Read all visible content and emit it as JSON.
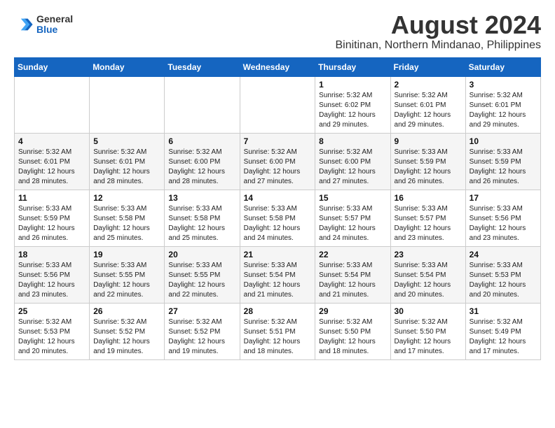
{
  "logo": {
    "general": "General",
    "blue": "Blue"
  },
  "title": {
    "month_year": "August 2024",
    "location": "Binitinan, Northern Mindanao, Philippines"
  },
  "weekdays": [
    "Sunday",
    "Monday",
    "Tuesday",
    "Wednesday",
    "Thursday",
    "Friday",
    "Saturday"
  ],
  "weeks": [
    [
      {
        "day": "",
        "info": ""
      },
      {
        "day": "",
        "info": ""
      },
      {
        "day": "",
        "info": ""
      },
      {
        "day": "",
        "info": ""
      },
      {
        "day": "1",
        "info": "Sunrise: 5:32 AM\nSunset: 6:02 PM\nDaylight: 12 hours\nand 29 minutes."
      },
      {
        "day": "2",
        "info": "Sunrise: 5:32 AM\nSunset: 6:01 PM\nDaylight: 12 hours\nand 29 minutes."
      },
      {
        "day": "3",
        "info": "Sunrise: 5:32 AM\nSunset: 6:01 PM\nDaylight: 12 hours\nand 29 minutes."
      }
    ],
    [
      {
        "day": "4",
        "info": "Sunrise: 5:32 AM\nSunset: 6:01 PM\nDaylight: 12 hours\nand 28 minutes."
      },
      {
        "day": "5",
        "info": "Sunrise: 5:32 AM\nSunset: 6:01 PM\nDaylight: 12 hours\nand 28 minutes."
      },
      {
        "day": "6",
        "info": "Sunrise: 5:32 AM\nSunset: 6:00 PM\nDaylight: 12 hours\nand 28 minutes."
      },
      {
        "day": "7",
        "info": "Sunrise: 5:32 AM\nSunset: 6:00 PM\nDaylight: 12 hours\nand 27 minutes."
      },
      {
        "day": "8",
        "info": "Sunrise: 5:32 AM\nSunset: 6:00 PM\nDaylight: 12 hours\nand 27 minutes."
      },
      {
        "day": "9",
        "info": "Sunrise: 5:33 AM\nSunset: 5:59 PM\nDaylight: 12 hours\nand 26 minutes."
      },
      {
        "day": "10",
        "info": "Sunrise: 5:33 AM\nSunset: 5:59 PM\nDaylight: 12 hours\nand 26 minutes."
      }
    ],
    [
      {
        "day": "11",
        "info": "Sunrise: 5:33 AM\nSunset: 5:59 PM\nDaylight: 12 hours\nand 26 minutes."
      },
      {
        "day": "12",
        "info": "Sunrise: 5:33 AM\nSunset: 5:58 PM\nDaylight: 12 hours\nand 25 minutes."
      },
      {
        "day": "13",
        "info": "Sunrise: 5:33 AM\nSunset: 5:58 PM\nDaylight: 12 hours\nand 25 minutes."
      },
      {
        "day": "14",
        "info": "Sunrise: 5:33 AM\nSunset: 5:58 PM\nDaylight: 12 hours\nand 24 minutes."
      },
      {
        "day": "15",
        "info": "Sunrise: 5:33 AM\nSunset: 5:57 PM\nDaylight: 12 hours\nand 24 minutes."
      },
      {
        "day": "16",
        "info": "Sunrise: 5:33 AM\nSunset: 5:57 PM\nDaylight: 12 hours\nand 23 minutes."
      },
      {
        "day": "17",
        "info": "Sunrise: 5:33 AM\nSunset: 5:56 PM\nDaylight: 12 hours\nand 23 minutes."
      }
    ],
    [
      {
        "day": "18",
        "info": "Sunrise: 5:33 AM\nSunset: 5:56 PM\nDaylight: 12 hours\nand 23 minutes."
      },
      {
        "day": "19",
        "info": "Sunrise: 5:33 AM\nSunset: 5:55 PM\nDaylight: 12 hours\nand 22 minutes."
      },
      {
        "day": "20",
        "info": "Sunrise: 5:33 AM\nSunset: 5:55 PM\nDaylight: 12 hours\nand 22 minutes."
      },
      {
        "day": "21",
        "info": "Sunrise: 5:33 AM\nSunset: 5:54 PM\nDaylight: 12 hours\nand 21 minutes."
      },
      {
        "day": "22",
        "info": "Sunrise: 5:33 AM\nSunset: 5:54 PM\nDaylight: 12 hours\nand 21 minutes."
      },
      {
        "day": "23",
        "info": "Sunrise: 5:33 AM\nSunset: 5:54 PM\nDaylight: 12 hours\nand 20 minutes."
      },
      {
        "day": "24",
        "info": "Sunrise: 5:33 AM\nSunset: 5:53 PM\nDaylight: 12 hours\nand 20 minutes."
      }
    ],
    [
      {
        "day": "25",
        "info": "Sunrise: 5:32 AM\nSunset: 5:53 PM\nDaylight: 12 hours\nand 20 minutes."
      },
      {
        "day": "26",
        "info": "Sunrise: 5:32 AM\nSunset: 5:52 PM\nDaylight: 12 hours\nand 19 minutes."
      },
      {
        "day": "27",
        "info": "Sunrise: 5:32 AM\nSunset: 5:52 PM\nDaylight: 12 hours\nand 19 minutes."
      },
      {
        "day": "28",
        "info": "Sunrise: 5:32 AM\nSunset: 5:51 PM\nDaylight: 12 hours\nand 18 minutes."
      },
      {
        "day": "29",
        "info": "Sunrise: 5:32 AM\nSunset: 5:50 PM\nDaylight: 12 hours\nand 18 minutes."
      },
      {
        "day": "30",
        "info": "Sunrise: 5:32 AM\nSunset: 5:50 PM\nDaylight: 12 hours\nand 17 minutes."
      },
      {
        "day": "31",
        "info": "Sunrise: 5:32 AM\nSunset: 5:49 PM\nDaylight: 12 hours\nand 17 minutes."
      }
    ]
  ]
}
